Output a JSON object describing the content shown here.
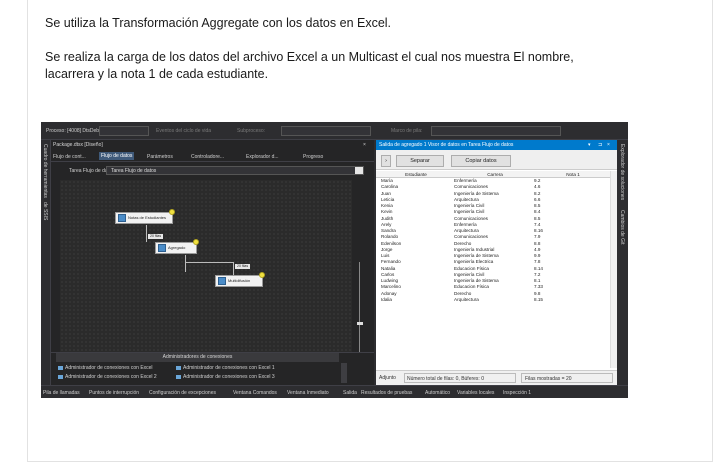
{
  "document": {
    "para1": "Se utiliza la Transformación Aggregate con los datos en Excel.",
    "para2": "Se realiza la carga de los datos del archivo Excel a un Multicast el cual nos muestra El nombre, lacarrera y la nota 1 de cada estudiante."
  },
  "ide": {
    "toolbar": {
      "process": "Proceso:  [4008] DtsDebugHost.exe",
      "events": "Eventos del ciclo de vida",
      "thread": "Subproceso:",
      "stack": "Marco de pila:"
    },
    "left_strip": {
      "toolbox": "Cuadro de herramientas",
      "ssis": "de SSIS"
    },
    "right_strip": {
      "solution": "Explorador de soluciones",
      "team": "Cambios de Git"
    },
    "designer": {
      "doc_tab": "Package.dtsx [Diseño]",
      "subtabs": [
        "Flujo de cont...",
        "Flujo de datos",
        "Parámetros",
        "Controladore...",
        "Explorador d...",
        "Progreso"
      ],
      "task_label": "Tarea Flujo de datos:",
      "task_value": "Tarea Flujo de datos",
      "nodes": {
        "source": "Notas de Estudiantes",
        "aggregate": "Agregado",
        "multicast": "Multidifusión"
      },
      "flow_labels": [
        "20 filas",
        "20 filas"
      ],
      "conn_manager_title": "Administradores de conexiones",
      "conn_items": [
        "Administrador de conexiones con Excel",
        "Administrador de conexiones con Excel 2",
        "Administrador de conexiones con Excel 1",
        "Administrador de conexiones con Excel 3"
      ]
    },
    "viewer": {
      "title": "Salida de agregado 1 Visor de datos en Tarea Flujo de datos",
      "detach_btn": "Separar",
      "copy_btn": "Copiar datos",
      "columns": [
        "Estudiante",
        "Carrera",
        "Nota 1"
      ],
      "rows": [
        [
          "María",
          "Enfermería",
          "9.2"
        ],
        [
          "Carolina",
          "Comunicaciones",
          "4.6"
        ],
        [
          "Juan",
          "Ingeniería de Sistema",
          "8.2"
        ],
        [
          "Leticia",
          "Arquitectura",
          "6.6"
        ],
        [
          "Kenia",
          "Ingeniería Civil",
          "8.5"
        ],
        [
          "Kevin",
          "Ingeniería Civil",
          "8.4"
        ],
        [
          "Judith",
          "Comunicaciones",
          "8.5"
        ],
        [
          "Arely",
          "Enfermería",
          "7.4"
        ],
        [
          "Sandra",
          "Arquitectura",
          "8.16"
        ],
        [
          "Rolando",
          "Comunicaciones",
          "7.9"
        ],
        [
          "Edenilson",
          "Derecho",
          "8.8"
        ],
        [
          "Jorge",
          "Ingeniería Industrial",
          "4.9"
        ],
        [
          "Luis",
          "Ingeniería de Sistema",
          "9.9"
        ],
        [
          "Fernando",
          "Ingeniería Electrica",
          "7.8"
        ],
        [
          "Natalia",
          "Educacion Física",
          "8.14"
        ],
        [
          "Carlos",
          "Ingeniería Civil",
          "7.2"
        ],
        [
          "Ludwing",
          "Ingeniería de Sistema",
          "8.1"
        ],
        [
          "Marcelino",
          "Educacion Física",
          "7.33"
        ],
        [
          "Adonay",
          "Derecho",
          "9.8"
        ],
        [
          "Idalia",
          "Arquitectura",
          "8.15"
        ]
      ],
      "status": {
        "state": "Adjunto",
        "total": "Número total de filas: 0, Búferes: 0",
        "shown": "Filas mostradas = 20"
      }
    },
    "bottom_tabs": [
      "Pila de llamadas",
      "Puntos de interrupción",
      "Configuración de excepciones",
      "Ventana Comandos",
      "Ventana Inmediato",
      "Salida",
      "Resultados de pruebas",
      "Automático",
      "Variables locales",
      "Inspección 1"
    ]
  }
}
